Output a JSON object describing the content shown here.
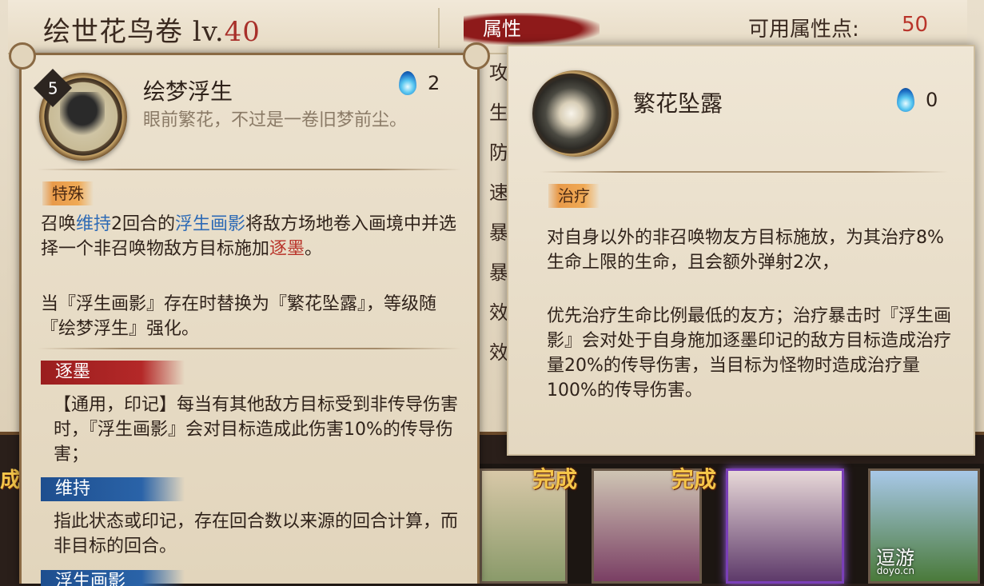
{
  "header": {
    "title": "绘世花鸟卷 ",
    "level_prefix": "lv.",
    "level_value": "40",
    "attr_tab": "属性",
    "points_label": "可用属性点:",
    "points_value": "50"
  },
  "attr_list": [
    "攻",
    "生",
    "防",
    "速",
    "暴",
    "暴",
    "效",
    "效"
  ],
  "skill_left": {
    "level": "5",
    "name": "绘梦浮生",
    "description": "眼前繁花，不过是一卷旧梦前尘。",
    "cost": "2",
    "tag": "特殊",
    "line1_a": "召唤",
    "line1_b": "维持",
    "line1_c": "2回合的",
    "line1_d": "浮生画影",
    "line1_e": "将敌方场地卷入画境中并选择一个非召唤物敌方目标施加",
    "line1_f": "逐墨",
    "line1_g": "。",
    "line2": "当『浮生画影』存在时替换为『繁花坠露』，等级随『绘梦浮生』强化。",
    "effect1_title": "逐墨",
    "effect1_text": "【通用，印记】每当有其他敌方目标受到非传导伤害时，『浮生画影』会对目标造成此伤害10%的传导伤害；",
    "effect2_title": "维持",
    "effect2_text": "指此状态或印记，存在回合数以来源的回合计算，而非目标的回合。",
    "effect3_title": "浮生画影"
  },
  "skill_right": {
    "name": "繁花坠露",
    "cost": "0",
    "tag": "治疗",
    "para1": "对自身以外的非召唤物友方目标施放，为其治疗8%生命上限的生命，且会额外弹射2次，",
    "para2": "优先治疗生命比例最低的友方；治疗暴击时『浮生画影』会对处于自身施加逐墨印记的敌方目标造成治疗量20%的传导伤害，当目标为怪物时造成治疗量100%的传导伤害。"
  },
  "cards": {
    "done_label": "完成",
    "edge_label": "成"
  },
  "watermark": {
    "text": "逗游",
    "domain": "doyo.cn"
  }
}
